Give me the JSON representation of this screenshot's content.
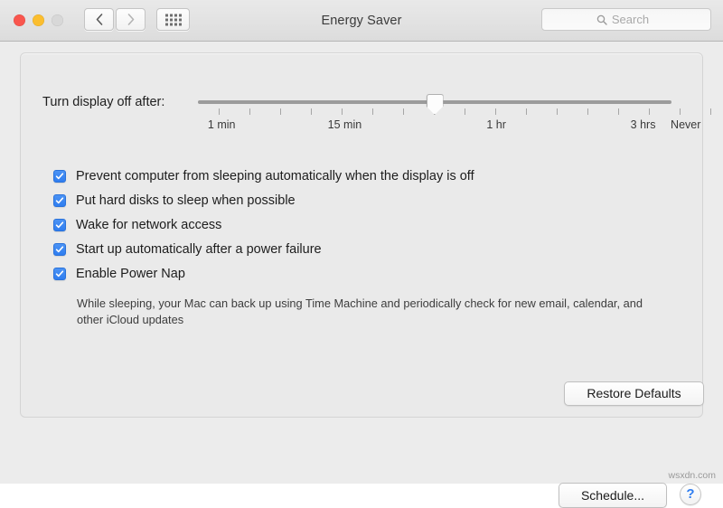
{
  "window": {
    "title": "Energy Saver",
    "traffic_lights": [
      {
        "name": "close",
        "color": "#f9564e"
      },
      {
        "name": "minimize",
        "color": "#fbbe2f"
      },
      {
        "name": "zoom",
        "color": "#d8d8d8"
      }
    ],
    "back_icon": "chevron-left-icon",
    "forward_icon": "chevron-right-icon",
    "show_all_icon": "grid-dots-icon"
  },
  "search": {
    "icon": "search-icon",
    "placeholder": "Search",
    "value": ""
  },
  "slider": {
    "label": "Turn display off after:",
    "thumb_position_percent": 50,
    "tick_count": 17,
    "scale_labels": [
      {
        "text": "1 min",
        "position_percent": 5
      },
      {
        "text": "15 min",
        "position_percent": 31
      },
      {
        "text": "1 hr",
        "position_percent": 63
      },
      {
        "text": "3 hrs",
        "position_percent": 94
      },
      {
        "text": "Never",
        "position_percent": 103
      }
    ]
  },
  "checkboxes": [
    {
      "label": "Prevent computer from sleeping automatically when the display is off",
      "checked": true,
      "name": "prevent-sleep"
    },
    {
      "label": "Put hard disks to sleep when possible",
      "checked": true,
      "name": "hard-disk-sleep"
    },
    {
      "label": "Wake for network access",
      "checked": true,
      "name": "wake-network"
    },
    {
      "label": "Start up automatically after a power failure",
      "checked": true,
      "name": "startup-power-failure"
    },
    {
      "label": "Enable Power Nap",
      "checked": true,
      "name": "power-nap"
    }
  ],
  "power_nap_description": "While sleeping, your Mac can back up using Time Machine and periodically check for new email, calendar, and other iCloud updates",
  "buttons": {
    "restore_defaults": "Restore Defaults",
    "schedule": "Schedule...",
    "help": "?"
  },
  "watermark": "wsxdn.com",
  "colors": {
    "accent": "#2f7df0",
    "window_bg": "#ececec",
    "panel_bg": "#eaeaea"
  }
}
